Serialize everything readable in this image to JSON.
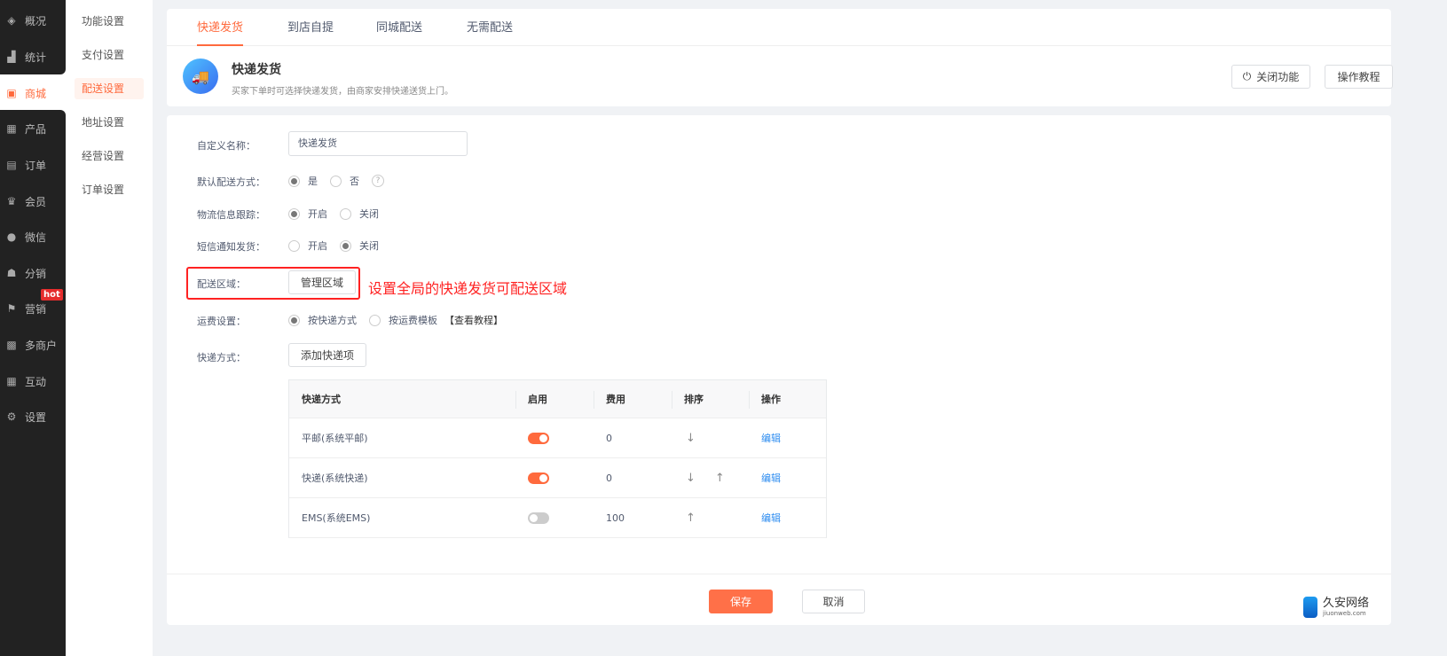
{
  "sidebar": {
    "items": [
      {
        "label": "概况",
        "icon": "layers-icon",
        "glyph": "◈"
      },
      {
        "label": "统计",
        "icon": "chart-icon",
        "glyph": "▟"
      },
      {
        "label": "商城",
        "icon": "shop-icon",
        "glyph": "▣"
      },
      {
        "label": "产品",
        "icon": "grid-icon",
        "glyph": "▦"
      },
      {
        "label": "订单",
        "icon": "clipboard-icon",
        "glyph": "▤"
      },
      {
        "label": "会员",
        "icon": "crown-icon",
        "glyph": "♛"
      },
      {
        "label": "微信",
        "icon": "wechat-icon",
        "glyph": "●"
      },
      {
        "label": "分销",
        "icon": "users-icon",
        "glyph": "☗"
      },
      {
        "label": "营销",
        "icon": "flag-icon",
        "glyph": "⚑"
      },
      {
        "label": "多商户",
        "icon": "store-icon",
        "glyph": "▩"
      },
      {
        "label": "互动",
        "icon": "apps-icon",
        "glyph": "▦"
      },
      {
        "label": "设置",
        "icon": "gear-icon",
        "glyph": "⚙"
      }
    ],
    "hot_badge": "hot"
  },
  "submenu": [
    "功能设置",
    "支付设置",
    "配送设置",
    "地址设置",
    "经营设置",
    "订单设置"
  ],
  "tabs": [
    "快递发货",
    "到店自提",
    "同城配送",
    "无需配送"
  ],
  "header": {
    "title": "快递发货",
    "description": "买家下单时可选择快递发货，由商家安排快递送货上门。",
    "close_button": "关闭功能",
    "tutorial_button": "操作教程"
  },
  "form": {
    "name_label": "自定义名称：",
    "name_value": "快递发货",
    "default_label": "默认配送方式：",
    "yes": "是",
    "no": "否",
    "help": "?",
    "tracking_label": "物流信息跟踪：",
    "on": "开启",
    "off": "关闭",
    "sms_label": "短信通知发货：",
    "area_label": "配送区域：",
    "area_button": "管理区域",
    "annotation": "设置全局的快递发货可配送区域",
    "freight_label": "运费设置：",
    "freight_opt1": "按快递方式",
    "freight_opt2": "按运费模板",
    "tutorial_link": "【查看教程】",
    "express_label": "快递方式：",
    "add_button": "添加快递项"
  },
  "table": {
    "headers": [
      "快递方式",
      "启用",
      "费用",
      "排序",
      "操作"
    ],
    "rows": [
      {
        "name": "平邮(系统平邮)",
        "enabled": true,
        "fee": "0",
        "down": true,
        "up": false,
        "action": "编辑"
      },
      {
        "name": "快递(系统快递)",
        "enabled": true,
        "fee": "0",
        "down": true,
        "up": true,
        "action": "编辑"
      },
      {
        "name": "EMS(系统EMS)",
        "enabled": false,
        "fee": "100",
        "down": false,
        "up": true,
        "action": "编辑"
      }
    ]
  },
  "footer": {
    "save": "保存",
    "cancel": "取消"
  },
  "watermark": {
    "name": "久安网络",
    "site": "jiuonweb.com"
  },
  "colors": {
    "accent": "#ff6a3d",
    "sidebar": "#222222",
    "link": "#2d8cf0"
  }
}
